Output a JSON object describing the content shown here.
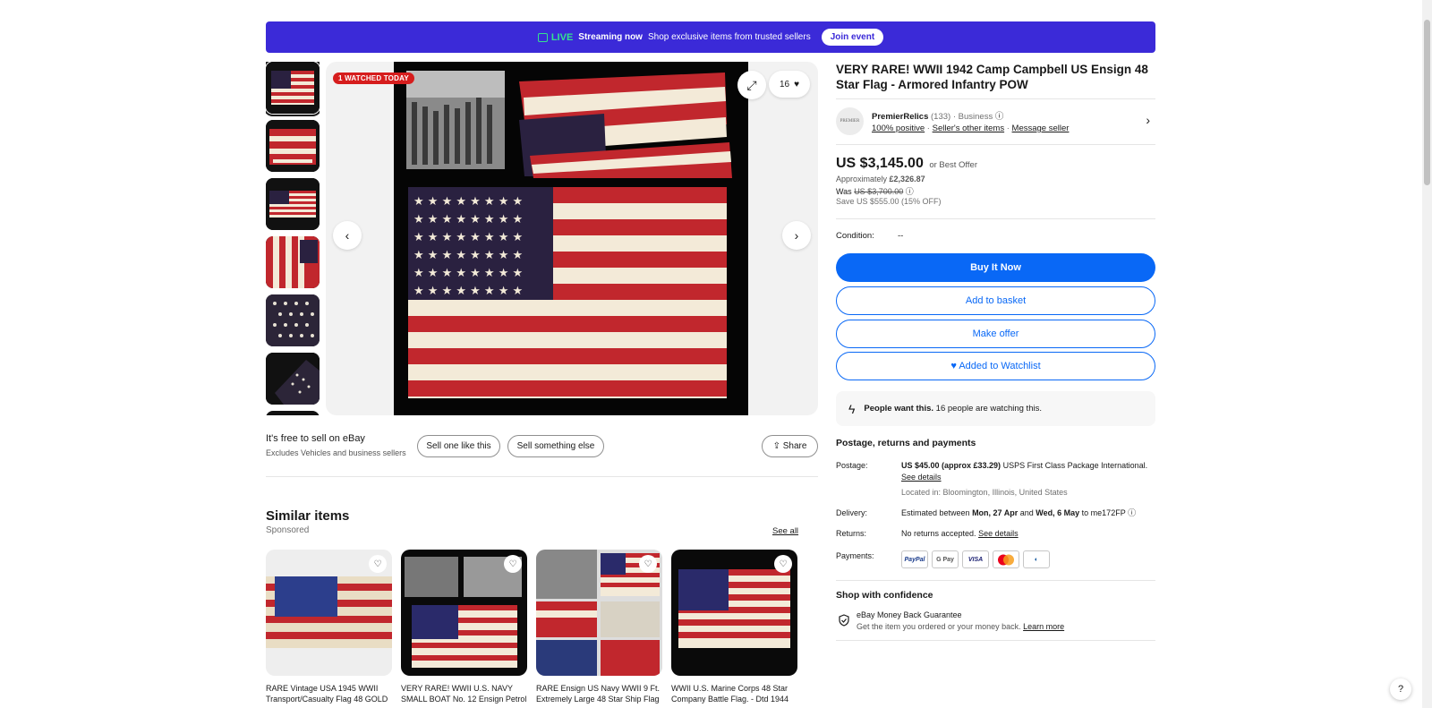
{
  "banner": {
    "live": "LIVE",
    "streaming": "Streaming now",
    "text": "Shop exclusive items from trusted sellers",
    "join": "Join event"
  },
  "gallery": {
    "badge": "1 WATCHED TODAY",
    "watch_count": "16",
    "icons": [
      "expand-icon",
      "heart-icon",
      "chevron-left-icon",
      "chevron-right-icon"
    ]
  },
  "sell": {
    "line1": "It's free to sell on eBay",
    "line2": "Excludes Vehicles and business sellers",
    "btn1": "Sell one like this",
    "btn2": "Sell something else",
    "share": "Share"
  },
  "similar": {
    "title": "Similar items",
    "sponsored": "Sponsored",
    "see_all": "See all",
    "items": [
      {
        "title": "RARE Vintage USA 1945 WWII Transport/Casualty Flag 48 GOLD"
      },
      {
        "title": "VERY RARE! WWII U.S. NAVY SMALL BOAT No. 12 Ensign Petrol"
      },
      {
        "title": "RARE Ensign US Navy WWII 9 Ft. Extremely Large 48 Star Ship Flag"
      },
      {
        "title": "WWII U.S. Marine Corps 48 Star Company Battle Flag. - Dtd 1944"
      }
    ]
  },
  "item": {
    "title": "VERY RARE! WWII 1942 Camp Campbell US Ensign 48 Star Flag - Armored Infantry POW"
  },
  "seller": {
    "avatar_text": "PREMIER",
    "name": "PremierRelics",
    "count": "(133)",
    "type": "· Business",
    "positive": "100% positive",
    "other_items": "Seller's other items",
    "message": "Message seller"
  },
  "pricing": {
    "price": "US $3,145.00",
    "best_offer": "or Best Offer",
    "approx_label": "Approximately",
    "approx_value": "£2,326.87",
    "was_label": "Was",
    "was_value": "US $3,700.00",
    "save": "Save US $555.00 (15% OFF)"
  },
  "condition": {
    "label": "Condition:",
    "value": "--"
  },
  "actions": {
    "buy": "Buy It Now",
    "basket": "Add to basket",
    "offer": "Make offer",
    "watchlist": "♥ Added to Watchlist"
  },
  "people": {
    "bold": "People want this.",
    "text": "16 people are watching this."
  },
  "postage": {
    "heading": "Postage, returns and payments",
    "postage_label": "Postage:",
    "postage_value": "US $45.00 (approx £33.29)",
    "postage_service": "USPS First Class Package International.",
    "see_details": "See details",
    "located": "Located in: Bloomington, Illinois, United States",
    "delivery_label": "Delivery:",
    "delivery_pre": "Estimated between",
    "delivery_d1": "Mon, 27 Apr",
    "delivery_and": "and",
    "delivery_d2": "Wed, 6 May",
    "delivery_post": "to me172FP",
    "returns_label": "Returns:",
    "returns_value": "No returns accepted.",
    "returns_details": "See details",
    "payments_label": "Payments:",
    "payment_methods": [
      "PayPal",
      "G Pay",
      "VISA",
      "MC",
      "D"
    ]
  },
  "confidence": {
    "heading": "Shop with confidence",
    "line1": "eBay Money Back Guarantee",
    "line2": "Get the item you ordered or your money back.",
    "learn_more": "Learn more"
  },
  "help": "?"
}
